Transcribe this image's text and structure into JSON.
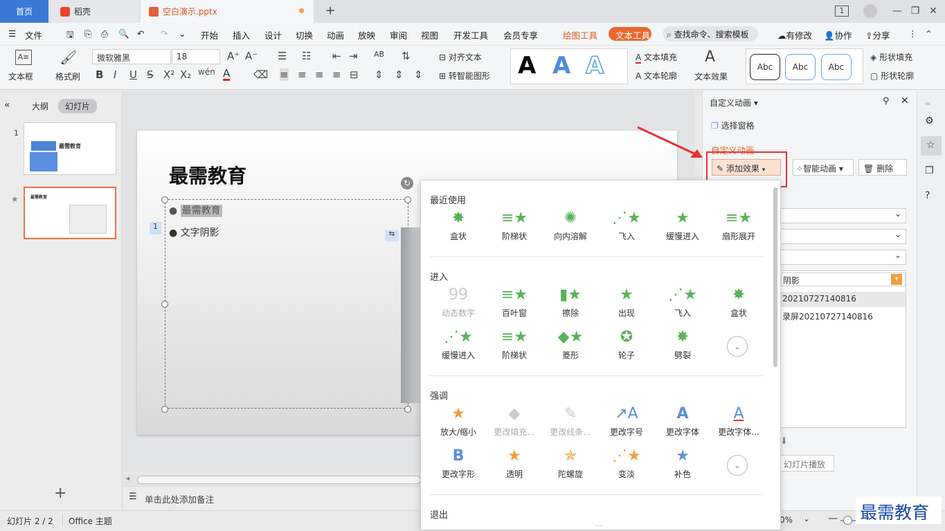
{
  "tabs": {
    "home": "首页",
    "daoke": "稻壳",
    "doc": "空白演示.pptx"
  },
  "window": {
    "page_btn": "1"
  },
  "menu": {
    "file": "文件",
    "items": [
      "开始",
      "插入",
      "设计",
      "切换",
      "动画",
      "放映",
      "审阅",
      "视图",
      "开发工具",
      "会员专享"
    ],
    "drawing_tools": "绘图工具",
    "text_tools": "文本工具",
    "search": "查找命令、搜索模板",
    "changes": "有修改",
    "collab": "协作",
    "share": "分享"
  },
  "ribbon": {
    "textbox": "文本框",
    "format_painter": "格式刷",
    "font": "微软雅黑",
    "size": "18",
    "align_text": "对齐文本",
    "smartart": "转智能图形",
    "text_fill": "文本填充",
    "text_outline": "文本轮廓",
    "text_effect": "文本效果",
    "abc": [
      "Abc",
      "Abc",
      "Abc"
    ],
    "shape_fill": "形状填充",
    "shape_outline": "形状轮廓"
  },
  "left": {
    "outline_tab": "大纲",
    "slides_tab": "幻灯片",
    "num1": "1",
    "thumb_title": "最需教育"
  },
  "slide": {
    "title": "最需教育",
    "bullets": [
      "最需教育",
      "文字阴影"
    ],
    "anim_num": "1"
  },
  "notes": {
    "placeholder": "单击此处添加备注"
  },
  "status": {
    "slide": "幻灯片 2 / 2",
    "theme": "Office 主题",
    "zoom": "0%"
  },
  "pane": {
    "title": "自定义动画",
    "select_window": "选择窗格",
    "heading": "自定义动画",
    "add_effect": "添加效果",
    "smart_anim": "智能动画",
    "delete": "删除",
    "item_text": "阴影",
    "list_1": "20210727140816",
    "list_2": "录屏20210727140816",
    "play": "幻灯片播放"
  },
  "dropdown": {
    "recent_title": "最近使用",
    "recent": [
      "盒状",
      "阶梯状",
      "向内溶解",
      "飞入",
      "缓慢进入",
      "扇形展开"
    ],
    "enter_title": "进入",
    "enter": [
      "动态数字",
      "百叶窗",
      "擦除",
      "出现",
      "飞入",
      "盒状",
      "缓慢进入",
      "阶梯状",
      "菱形",
      "轮子",
      "劈裂"
    ],
    "emph_title": "强调",
    "emph": [
      "放大/缩小",
      "更改填充...",
      "更改线条...",
      "更改字号",
      "更改字体",
      "更改字体...",
      "更改字形",
      "透明",
      "陀螺旋",
      "变淡",
      "补色"
    ],
    "exit_title": "退出"
  },
  "watermark": "最需教育"
}
